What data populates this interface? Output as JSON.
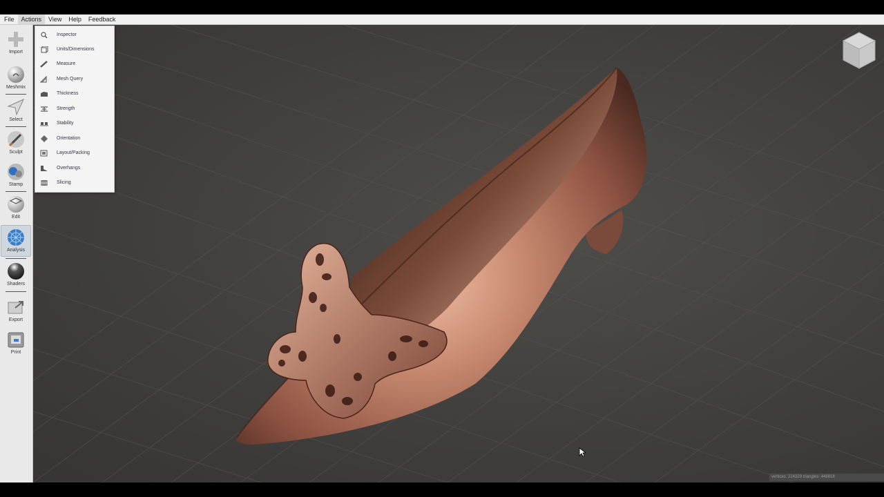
{
  "menubar": {
    "items": [
      "File",
      "Actions",
      "View",
      "Help",
      "Feedback"
    ]
  },
  "toolbar": {
    "tools": [
      {
        "label": "Import",
        "icon": "plus-icon"
      },
      {
        "label": "Meshmix",
        "icon": "meshmix-sphere-icon"
      },
      {
        "label": "Select",
        "icon": "select-arrow-icon"
      },
      {
        "label": "Sculpt",
        "icon": "sculpt-brush-icon"
      },
      {
        "label": "Stamp",
        "icon": "stamp-icon"
      },
      {
        "label": "Edit",
        "icon": "edit-sphere-icon"
      },
      {
        "label": "Analysis",
        "icon": "analysis-icon"
      },
      {
        "label": "Shaders",
        "icon": "shaders-sphere-icon"
      },
      {
        "label": "Export",
        "icon": "export-icon"
      },
      {
        "label": "Print",
        "icon": "print-icon"
      }
    ],
    "active": "Analysis"
  },
  "analysis_menu": {
    "items": [
      {
        "label": "Inspector",
        "icon": "magnifier-icon"
      },
      {
        "label": "Units/Dimensions",
        "icon": "units-box-icon"
      },
      {
        "label": "Measure",
        "icon": "ruler-icon"
      },
      {
        "label": "Mesh Query",
        "icon": "mesh-query-icon"
      },
      {
        "label": "Thickness",
        "icon": "thickness-icon"
      },
      {
        "label": "Strength",
        "icon": "strength-icon"
      },
      {
        "label": "Stability",
        "icon": "stability-icon"
      },
      {
        "label": "Orientation",
        "icon": "orientation-icon"
      },
      {
        "label": "Layout/Packing",
        "icon": "layout-packing-icon"
      },
      {
        "label": "Overhangs",
        "icon": "overhangs-icon"
      },
      {
        "label": "Slicing",
        "icon": "slicing-icon"
      }
    ]
  },
  "status": {
    "text": "vertices: 224329 triangles: 448818"
  },
  "colors": {
    "model": "#b0705a",
    "viewport": "#434240",
    "menu_bg": "#f4f4f4"
  }
}
